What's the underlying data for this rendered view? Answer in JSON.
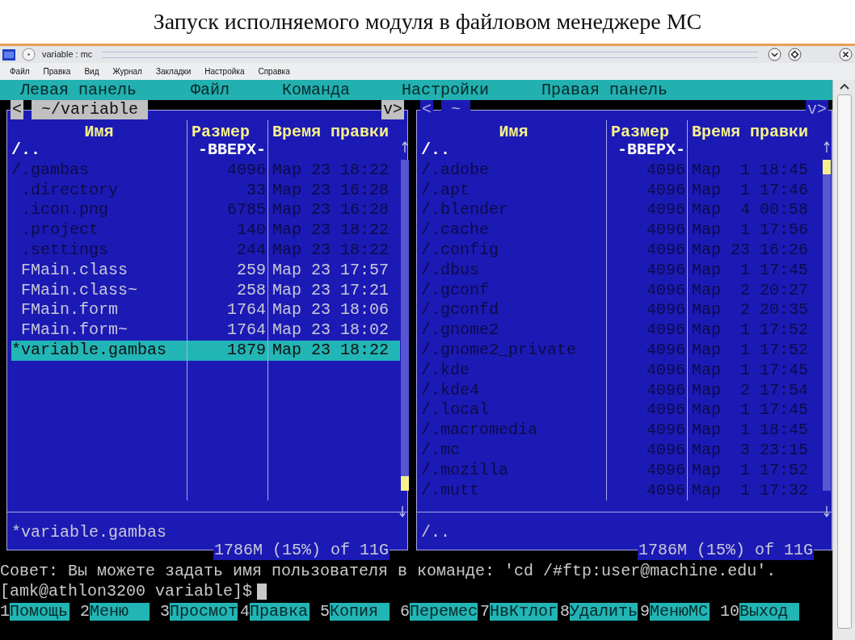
{
  "slide_title": "Запуск исполняемого модуля в файловом менеджере MC",
  "window": {
    "title": "variable : mc",
    "menu": [
      "Файл",
      "Правка",
      "Вид",
      "Журнал",
      "Закладки",
      "Настройка",
      "Справка"
    ]
  },
  "mc_menu": [
    "Левая панель",
    "Файл",
    "Команда",
    "Настройки",
    "Правая панель"
  ],
  "panels": [
    {
      "active": true,
      "prev": "<",
      "path": "~/variable",
      "next": "v>",
      "columns": [
        "Имя",
        "Размер",
        "Время правки"
      ],
      "status": "*variable.gambas",
      "disk": "1786M (15%) of 11G",
      "rows": [
        {
          "kind": "updir",
          "name": "/..",
          "size": "-ВВЕРХ-",
          "selected": false
        },
        {
          "kind": "hidden_dir",
          "name": "/.gambas",
          "size": "4096",
          "date": "Мар 23 18:22",
          "selected": false
        },
        {
          "kind": "hidden_file",
          "name": ".directory",
          "size": "33",
          "date": "Мар 23 16:28",
          "selected": false
        },
        {
          "kind": "hidden_file",
          "name": ".icon.png",
          "size": "6785",
          "date": "Мар 23 16:28",
          "selected": false
        },
        {
          "kind": "hidden_file",
          "name": ".project",
          "size": "140",
          "date": "Мар 23 18:22",
          "selected": false
        },
        {
          "kind": "hidden_file",
          "name": ".settings",
          "size": "244",
          "date": "Мар 23 18:22",
          "selected": false
        },
        {
          "kind": "file",
          "name": "FMain.class",
          "size": "259",
          "date": "Мар 23 17:57",
          "selected": false
        },
        {
          "kind": "file",
          "name": "FMain.class~",
          "size": "258",
          "date": "Мар 23 17:21",
          "selected": false
        },
        {
          "kind": "file",
          "name": "FMain.form",
          "size": "1764",
          "date": "Мар 23 18:06",
          "selected": false
        },
        {
          "kind": "file",
          "name": "FMain.form~",
          "size": "1764",
          "date": "Мар 23 18:02",
          "selected": false
        },
        {
          "kind": "exec",
          "name": "*variable.gambas",
          "size": "1879",
          "date": "Мар 23 18:22",
          "selected": true
        }
      ]
    },
    {
      "active": false,
      "prev": "<",
      "path": "~",
      "next": "v>",
      "columns": [
        "Имя",
        "Размер",
        "Время правки"
      ],
      "status": "/..",
      "disk": "1786M (15%) of 11G",
      "rows": [
        {
          "kind": "updir",
          "name": "/..",
          "size": "-ВВЕРХ-",
          "selected": false
        },
        {
          "kind": "hidden_dir",
          "name": "/.adobe",
          "size": "4096",
          "date": "Мар  1 18:45",
          "selected": false
        },
        {
          "kind": "hidden_dir",
          "name": "/.apt",
          "size": "4096",
          "date": "Мар  1 17:46",
          "selected": false
        },
        {
          "kind": "hidden_dir",
          "name": "/.blender",
          "size": "4096",
          "date": "Мар  4 00:58",
          "selected": false
        },
        {
          "kind": "hidden_dir",
          "name": "/.cache",
          "size": "4096",
          "date": "Мар  1 17:56",
          "selected": false
        },
        {
          "kind": "hidden_dir",
          "name": "/.config",
          "size": "4096",
          "date": "Мар 23 16:26",
          "selected": false
        },
        {
          "kind": "hidden_dir",
          "name": "/.dbus",
          "size": "4096",
          "date": "Мар  1 17:45",
          "selected": false
        },
        {
          "kind": "hidden_dir",
          "name": "/.gconf",
          "size": "4096",
          "date": "Мар  2 20:27",
          "selected": false
        },
        {
          "kind": "hidden_dir",
          "name": "/.gconfd",
          "size": "4096",
          "date": "Мар  2 20:35",
          "selected": false
        },
        {
          "kind": "hidden_dir",
          "name": "/.gnome2",
          "size": "4096",
          "date": "Мар  1 17:52",
          "selected": false
        },
        {
          "kind": "hidden_dir",
          "name": "/.gnome2_private",
          "size": "4096",
          "date": "Мар  1 17:52",
          "selected": false
        },
        {
          "kind": "hidden_dir",
          "name": "/.kde",
          "size": "4096",
          "date": "Мар  1 17:45",
          "selected": false
        },
        {
          "kind": "hidden_dir",
          "name": "/.kde4",
          "size": "4096",
          "date": "Мар  2 17:54",
          "selected": false
        },
        {
          "kind": "hidden_dir",
          "name": "/.local",
          "size": "4096",
          "date": "Мар  1 17:45",
          "selected": false
        },
        {
          "kind": "hidden_dir",
          "name": "/.macromedia",
          "size": "4096",
          "date": "Мар  1 18:45",
          "selected": false
        },
        {
          "kind": "hidden_dir",
          "name": "/.mc",
          "size": "4096",
          "date": "Мар  3 23:15",
          "selected": false
        },
        {
          "kind": "hidden_dir",
          "name": "/.mozilla",
          "size": "4096",
          "date": "Мар  1 17:52",
          "selected": false
        },
        {
          "kind": "hidden_dir",
          "name": "/.mutt",
          "size": "4096",
          "date": "Мар  1 17:32",
          "selected": false
        }
      ]
    }
  ],
  "hint": "Совет: Вы можете задать имя пользователя в команде: 'cd /#ftp:user@machine.edu'.",
  "prompt": "[amk@athlon3200 variable]$",
  "fkeys": [
    {
      "num": "1",
      "label": "Помощь"
    },
    {
      "num": "2",
      "label": "Меню"
    },
    {
      "num": "3",
      "label": "Просмот"
    },
    {
      "num": "4",
      "label": "Правка"
    },
    {
      "num": "5",
      "label": "Копия"
    },
    {
      "num": "6",
      "label": "Перемес"
    },
    {
      "num": "7",
      "label": "НвКтлог"
    },
    {
      "num": "8",
      "label": "Удалить"
    },
    {
      "num": "9",
      "label": "МенюМС"
    },
    {
      "num": "10",
      "label": "Выход"
    }
  ]
}
